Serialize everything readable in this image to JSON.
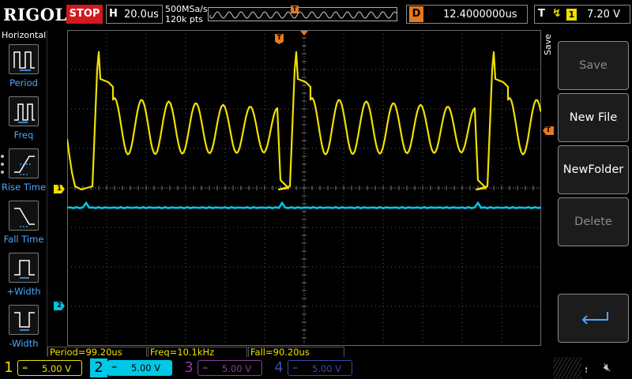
{
  "topbar": {
    "brand": "RIGOL",
    "run_state": "STOP",
    "horizontal_label": "H",
    "timebase": "20.0us",
    "sample_rate": "500MSa/s",
    "memory_depth": "120k pts",
    "trigger_marker": "T",
    "delay_label": "D",
    "delay_value": "12.4000000us",
    "trigger_label": "T",
    "trigger_edge": "rising",
    "trigger_source": "1",
    "trigger_level": "7.20 V"
  },
  "left_menu": {
    "title": "Horizontal",
    "items": [
      {
        "label": "Period",
        "icon": "period-icon"
      },
      {
        "label": "Freq",
        "icon": "frequency-icon"
      },
      {
        "label": "Rise Time",
        "icon": "rise-time-icon"
      },
      {
        "label": "Fall Time",
        "icon": "fall-time-icon"
      },
      {
        "label": "+Width",
        "icon": "positive-width-icon"
      },
      {
        "label": "-Width",
        "icon": "negative-width-icon"
      }
    ]
  },
  "markers": {
    "ch1": "1",
    "ch2": "2",
    "trigger_level": "T",
    "trigger_position": "T"
  },
  "measurements": {
    "period": "Period=99.20us",
    "freq": "Freq=10.1kHz",
    "fall": "Fall=90.20us"
  },
  "right_menu": {
    "title": "Save",
    "softkeys": [
      {
        "label": "Save",
        "enabled": false
      },
      {
        "label": "New File",
        "enabled": true
      },
      {
        "label": "NewFolder",
        "enabled": true
      },
      {
        "label": "Delete",
        "enabled": false
      },
      {
        "label": "",
        "icon": "return-icon",
        "enabled": true
      }
    ]
  },
  "channels": [
    {
      "num": "1",
      "coupling": "DC",
      "scale": "5.00 V",
      "active": true,
      "color": "#f0e000"
    },
    {
      "num": "2",
      "coupling": "DC",
      "scale": "5.00 V",
      "active": true,
      "color": "#00c8e6"
    },
    {
      "num": "3",
      "coupling": "DC",
      "scale": "5.00 V",
      "active": false,
      "color": "#8a3c98"
    },
    {
      "num": "4",
      "coupling": "DC",
      "scale": "5.00 V",
      "active": false,
      "color": "#3c4aa8"
    }
  ],
  "status_icons": [
    "usb-icon",
    "speaker-muted-icon"
  ],
  "colors": {
    "ch1": "#f0e000",
    "ch2": "#00c8e6",
    "trigger": "#e8781e",
    "stop": "#d2191e",
    "menu_label": "#4aa8ff"
  }
}
